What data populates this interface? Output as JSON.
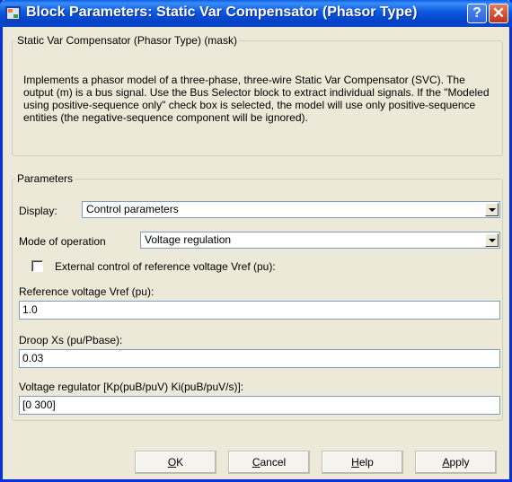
{
  "window": {
    "title": "Block Parameters: Static Var Compensator (Phasor Type)",
    "help_glyph": "?",
    "close_glyph": "✕"
  },
  "mask_group": {
    "legend": "Static Var Compensator (Phasor Type) (mask)",
    "description": "Implements a  phasor model of a three-phase, three-wire Static Var Compensator (SVC). The output (m) is a bus signal. Use the Bus Selector block to extract individual signals. If the \"Modeled using positive-sequence only\" check box is selected, the model will use only positive-sequence entities (the negative-sequence component will be ignored)."
  },
  "params_group": {
    "legend": "Parameters",
    "display_label": "Display:",
    "display_value": "Control parameters",
    "mode_label": "Mode of operation",
    "mode_value": "Voltage regulation",
    "external_control_label": "External control of reference voltage Vref (pu):",
    "external_control_checked": false,
    "vref_label": "Reference voltage Vref  (pu):",
    "vref_value": "1.0",
    "droop_label": "Droop Xs (pu/Pbase):",
    "droop_value": "0.03",
    "regulator_label": "Voltage regulator [Kp(puB/puV)  Ki(puB/puV/s)]:",
    "regulator_value": "[0 300]"
  },
  "buttons": {
    "ok_mnemonic": "O",
    "ok_rest": "K",
    "cancel_mnemonic": "C",
    "cancel_rest": "ancel",
    "help_mnemonic": "H",
    "help_rest": "elp",
    "apply_mnemonic": "A",
    "apply_rest": "pply"
  },
  "colors": {
    "titlebar": "#0a58e0",
    "frame": "#0831d9",
    "dialog_bg": "#ece9d8",
    "close_button": "#c0331a"
  },
  "icons": [
    "simulink-block-icon",
    "help-icon",
    "close-icon",
    "dropdown-arrow-icon"
  ]
}
